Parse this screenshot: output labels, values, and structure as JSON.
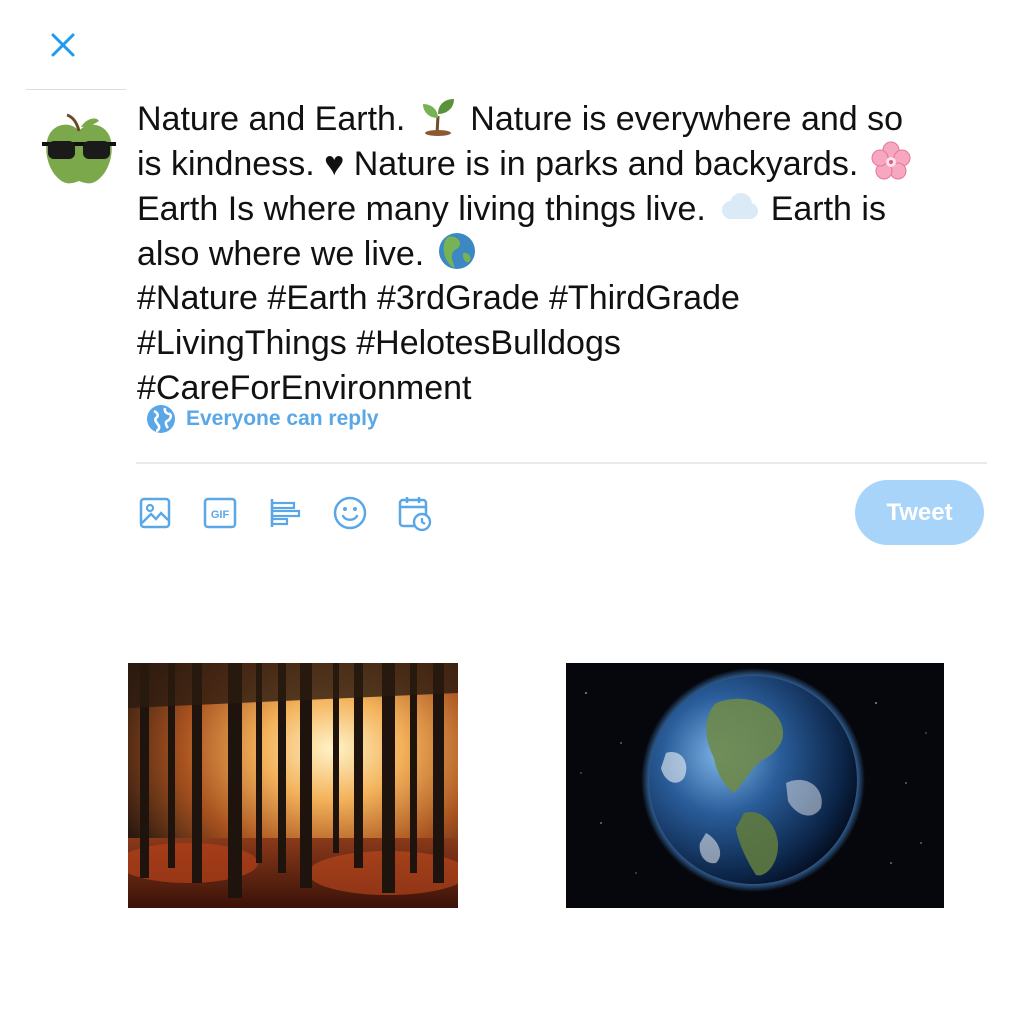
{
  "compose": {
    "close_icon": "close-icon",
    "accent_color": "#1da1f2",
    "text_lines": [
      [
        "Nature and Earth. ",
        "seedling-emoji",
        " Nature is everywhere and so"
      ],
      [
        "is kindness. ♥ Nature is in parks and backyards. ",
        "cherry-blossom-emoji",
        ""
      ],
      [
        "Earth Is where many living things live. ",
        "cloud-emoji",
        " Earth is"
      ],
      [
        "also where we live. ",
        "globe-americas-emoji",
        ""
      ],
      [
        "#Nature #Earth #3rdGrade #ThirdGrade"
      ],
      [
        "#LivingThings #HelotesBulldogs"
      ],
      [
        "#CareForEnvironment"
      ]
    ],
    "reply_setting": {
      "icon": "globe-icon",
      "label": "Everyone can reply"
    },
    "toolbar": [
      {
        "name": "image-icon"
      },
      {
        "name": "gif-icon",
        "label": "GIF"
      },
      {
        "name": "poll-icon"
      },
      {
        "name": "emoji-icon"
      },
      {
        "name": "schedule-icon"
      }
    ],
    "tweet_button": {
      "label": "Tweet",
      "color": "#a8d4fa"
    }
  },
  "attachments": [
    {
      "name": "forest-photo"
    },
    {
      "name": "earth-photo"
    }
  ]
}
